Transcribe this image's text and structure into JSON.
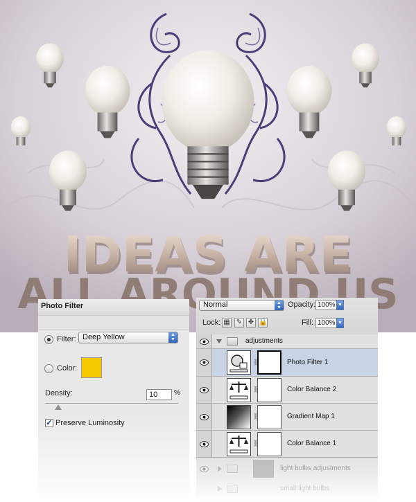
{
  "artwork": {
    "headline_line1": "IDEAS ARE",
    "headline_line2": "ALL AROUND US"
  },
  "photo_filter": {
    "title": "Photo Filter",
    "filter_label": "Filter:",
    "filter_value": "Deep Yellow",
    "color_label": "Color:",
    "color_swatch": "#f5c800",
    "density_label": "Density:",
    "density_value": "10",
    "density_unit": "%",
    "density_level": 0.1,
    "preserve_label": "Preserve Luminosity",
    "preserve_checked": true
  },
  "layers_panel": {
    "blend_mode": "Normal",
    "opacity_label": "Opacity:",
    "opacity_value": "100%",
    "lock_label": "Lock:",
    "fill_label": "Fill:",
    "fill_value": "100%",
    "layers": [
      {
        "name": "adjustments",
        "kind": "group",
        "icon": "folder-icon",
        "expanded": true
      },
      {
        "name": "Photo Filter 1",
        "kind": "adjustment",
        "icon": "photo-filter-icon",
        "selected": true
      },
      {
        "name": "Color Balance 2",
        "kind": "adjustment",
        "icon": "color-balance-icon"
      },
      {
        "name": "Gradient Map 1",
        "kind": "adjustment",
        "icon": "gradient-map-icon"
      },
      {
        "name": "Color Balance 1",
        "kind": "adjustment",
        "icon": "color-balance-icon"
      },
      {
        "name": "light bulbs adjustments",
        "kind": "group",
        "icon": "folder-icon",
        "expanded": false
      },
      {
        "name": "small light bulbs",
        "kind": "group",
        "icon": "folder-icon",
        "expanded": false
      }
    ]
  }
}
